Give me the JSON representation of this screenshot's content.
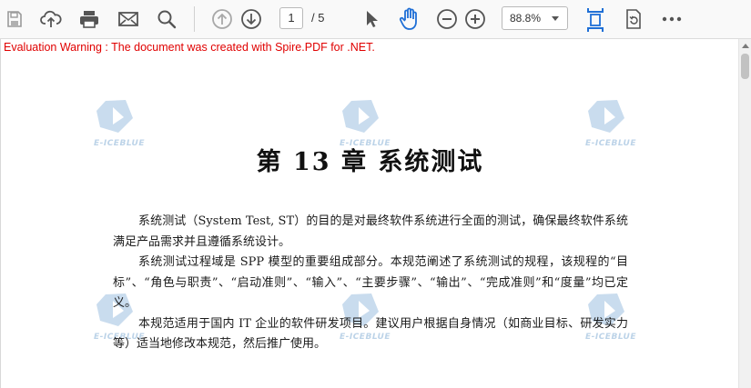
{
  "toolbar": {
    "page_current": "1",
    "page_total": "/ 5",
    "zoom": "88.8%",
    "icons": [
      "save-icon",
      "upload-icon",
      "print-icon",
      "email-icon",
      "search-icon",
      "page-up-icon",
      "page-down-icon",
      "select-cursor-icon",
      "hand-tool-icon",
      "zoom-out-icon",
      "zoom-in-icon",
      "fit-page-icon",
      "rotate-icon",
      "more-icon"
    ]
  },
  "colors": {
    "warning": "#e00000",
    "accent": "#1f6fd6",
    "watermark": "#bcd3e8"
  },
  "viewer": {
    "warning": "Evaluation Warning : The document was created with Spire.PDF for .NET.",
    "watermark_text": "E-ICEBLUE"
  },
  "document": {
    "title": "第 13 章  系统测试",
    "paragraphs": [
      "系统测试（System Test, ST）的目的是对最终软件系统进行全面的测试，确保最终软件系统满足产品需求并且遵循系统设计。",
      "系统测试过程域是 SPP 模型的重要组成部分。本规范阐述了系统测试的规程，该规程的“目标”、“角色与职责”、“启动准则”、“输入”、“主要步骤”、“输出”、“完成准则”和“度量”均已定义。",
      "本规范适用于国内 IT 企业的软件研发项目。建议用户根据自身情况（如商业目标、研发实力等）适当地修改本规范，然后推广使用。"
    ]
  }
}
